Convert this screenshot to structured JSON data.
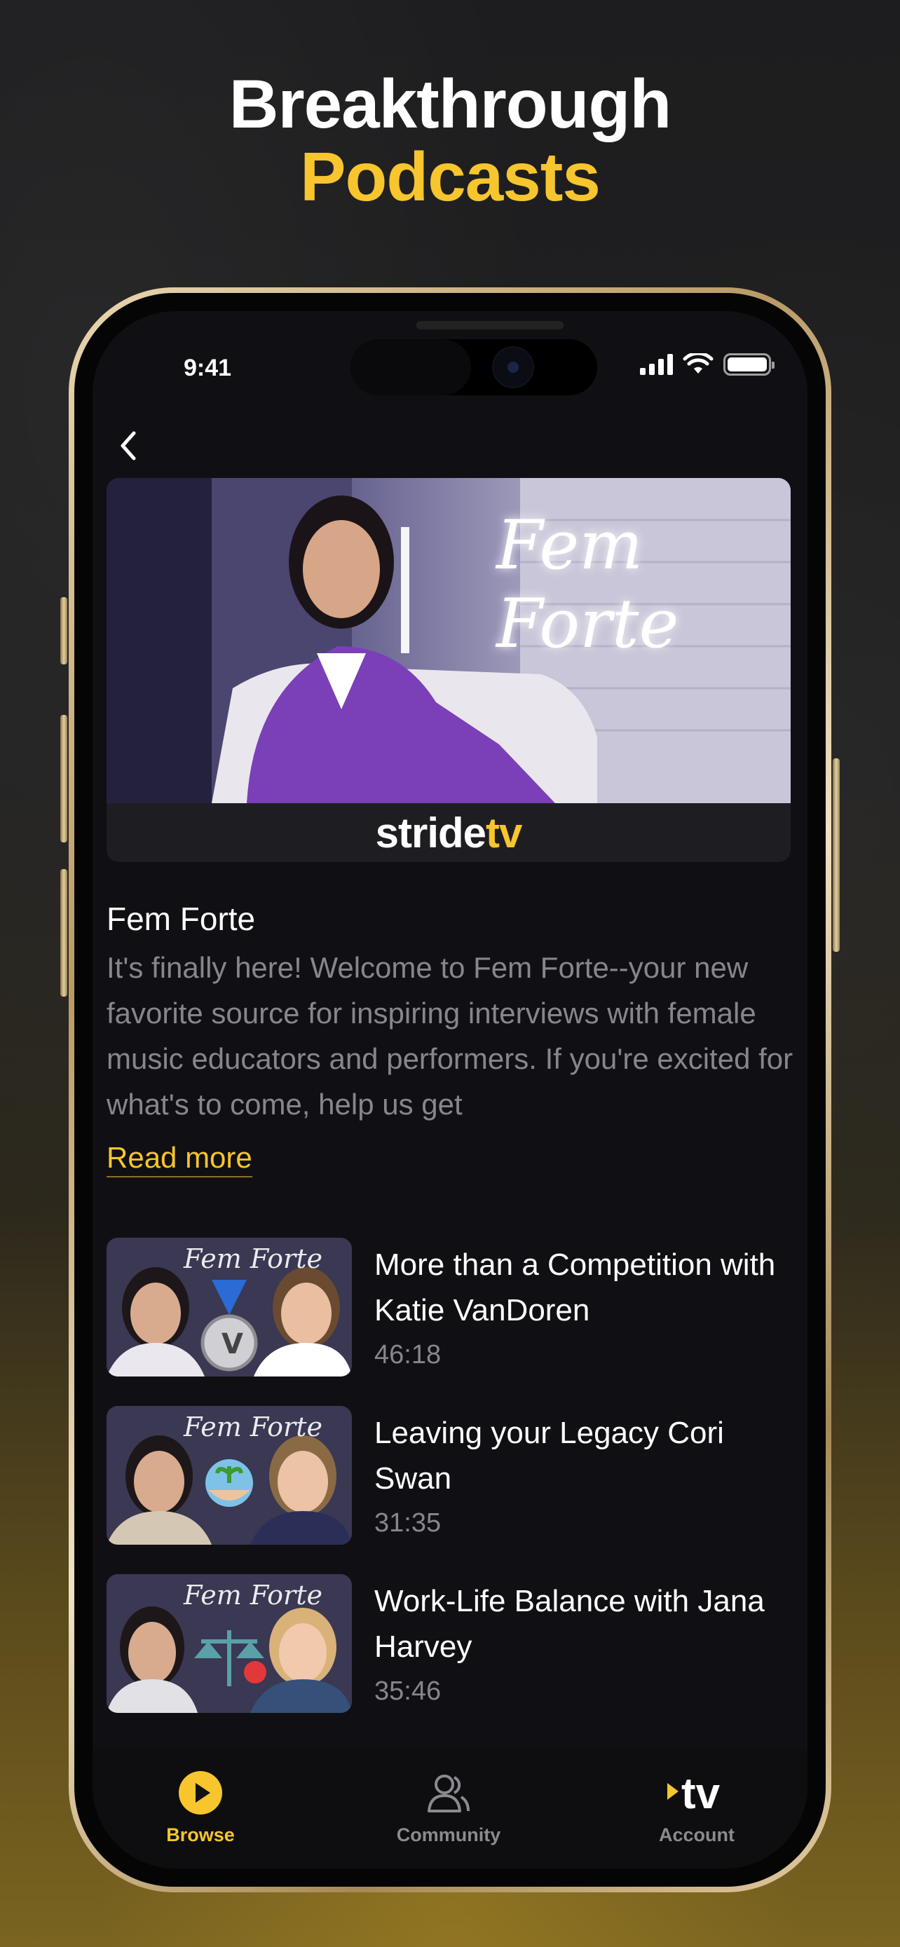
{
  "headline": {
    "line1": "Breakthrough",
    "line2": "Podcasts"
  },
  "status_bar": {
    "time": "9:41"
  },
  "hero": {
    "brand": "stride",
    "brand_accent": "tv",
    "overlay_script": "Fem Forte"
  },
  "podcast": {
    "title": "Fem Forte",
    "description": "It's finally here! Welcome to Fem Forte--your new favorite source for inspiring interviews with female music educators and performers. If you're excited for what's to come, help us get",
    "read_more": "Read more"
  },
  "episodes": [
    {
      "title": "More than a Competition with Katie VanDoren",
      "duration": "46:18",
      "thumb_script": "Fem Forte"
    },
    {
      "title": "Leaving your Legacy Cori Swan",
      "duration": "31:35",
      "thumb_script": "Fem Forte"
    },
    {
      "title": "Work-Life Balance with Jana Harvey",
      "duration": "35:46",
      "thumb_script": "Fem Forte"
    }
  ],
  "tabbar": {
    "items": [
      {
        "label": "Browse",
        "icon": "play-circle-icon",
        "active": true
      },
      {
        "label": "Community",
        "icon": "users-icon",
        "active": false
      },
      {
        "label": "Account",
        "icon": "tv-logo-icon",
        "active": false
      }
    ]
  },
  "colors": {
    "accent": "#f7c52d",
    "background": "#101014",
    "muted_text": "#86868c"
  }
}
